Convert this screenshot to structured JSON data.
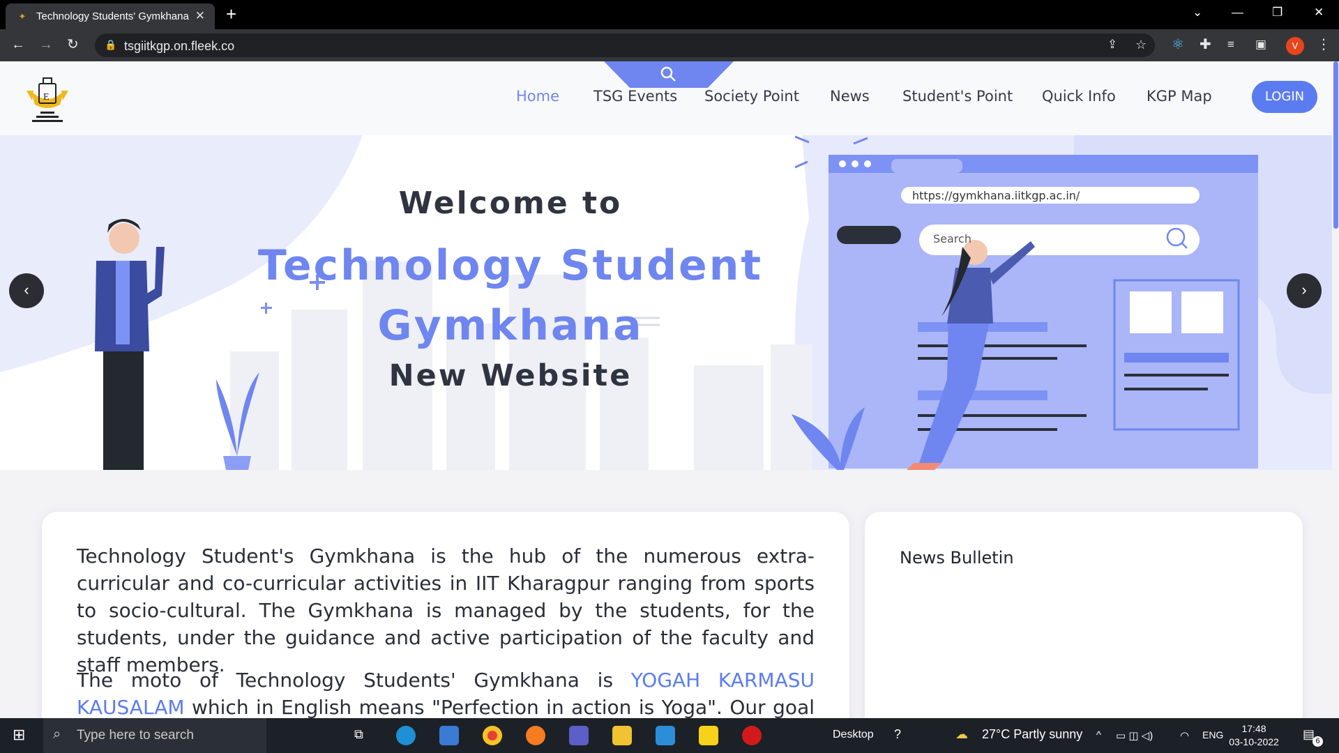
{
  "browser": {
    "tab_title": "Technology Students' Gymkhana",
    "url": "tsgiitkgp.on.fleek.co",
    "profile_initial": "V"
  },
  "nav": {
    "items": [
      "Home",
      "TSG Events",
      "Society Point",
      "News",
      "Student's Point",
      "Quick Info",
      "KGP Map"
    ],
    "active": "Home",
    "login_label": "LOGIN"
  },
  "hero": {
    "line1": "Welcome to",
    "line2": "Technology Student",
    "line3": "Gymkhana",
    "line4": "New Website",
    "illustration_url": "https://gymkhana.iitkgp.ac.in/",
    "illustration_search": "Search"
  },
  "about": {
    "para1": "Technology Student's Gymkhana is the hub of the numerous extra-curricular and co-curricular activities in IIT Kharagpur ranging from sports to socio-cultural. The Gymkhana is managed by the students, for the students, under the guidance and active participation of the faculty and staff members.",
    "para2_prefix": "The moto of Technology Students' Gymkhana is ",
    "para2_highlight": "YOGAH KARMASU KAUSALAM",
    "para2_suffix": " which in English means \"Perfection in action is Yoga\". Our goal is to bring overall"
  },
  "news": {
    "title": "News Bulletin"
  },
  "taskbar": {
    "search_placeholder": "Type here to search",
    "desktop_label": "Desktop",
    "weather": "27°C  Partly sunny",
    "language": "ENG",
    "time": "17:48",
    "date": "03-10-2022",
    "notifications": "6"
  },
  "colors": {
    "accent": "#6f86f0",
    "login": "#5b7cf0",
    "dark_text": "#2f3440"
  }
}
